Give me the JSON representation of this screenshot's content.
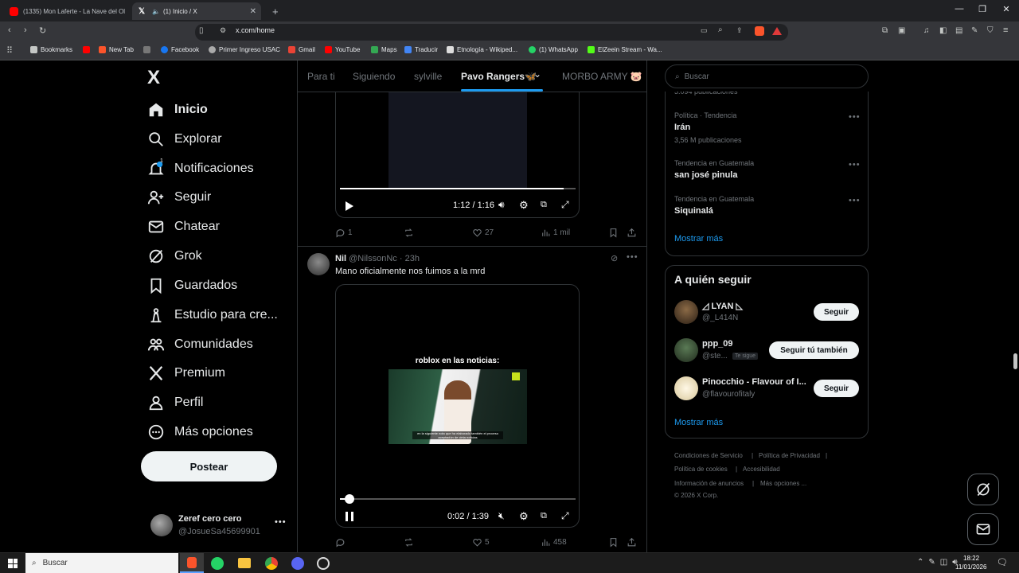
{
  "browser": {
    "tabs": [
      {
        "title": "(1335) Mon Laferte - La Nave del Ol",
        "active": false
      },
      {
        "title": "(1) Inicio / X",
        "active": true
      }
    ],
    "new_tab": "+",
    "url": "x.com/home",
    "bookmarks": [
      "Bookmarks",
      "New Tab",
      "Gmail",
      "Facebook",
      "Primer Ingreso USAC",
      "Gmail",
      "YouTube",
      "Maps",
      "Traducir",
      "Etnología - Wikiped...",
      "(1) WhatsApp",
      "ElZeein Stream - Wa..."
    ]
  },
  "sidebar": {
    "logo": "X",
    "items": [
      {
        "label": "Inicio",
        "icon": "home-icon"
      },
      {
        "label": "Explorar",
        "icon": "search-icon"
      },
      {
        "label": "Notificaciones",
        "icon": "bell-icon",
        "badge": "1"
      },
      {
        "label": "Seguir",
        "icon": "person-add-icon"
      },
      {
        "label": "Chatear",
        "icon": "mail-icon"
      },
      {
        "label": "Grok",
        "icon": "grok-icon"
      },
      {
        "label": "Guardados",
        "icon": "bookmark-icon"
      },
      {
        "label": "Estudio para cre...",
        "icon": "studio-icon"
      },
      {
        "label": "Comunidades",
        "icon": "communities-icon"
      },
      {
        "label": "Premium",
        "icon": "x-icon"
      },
      {
        "label": "Perfil",
        "icon": "person-icon"
      },
      {
        "label": "Más opciones",
        "icon": "more-icon"
      }
    ],
    "post_button": "Postear",
    "account": {
      "name": "Zeref cero cero",
      "handle": "@JosueSa45699901"
    }
  },
  "feed": {
    "tabs": [
      {
        "label": "Para ti"
      },
      {
        "label": "Siguiendo"
      },
      {
        "label": "sylville"
      },
      {
        "label": "Pavo Rangers🦋"
      },
      {
        "label": "MORBO ARMY 🐷"
      }
    ],
    "tweet1": {
      "time": "1:12 / 1:16",
      "progress": 0.95,
      "replies": "1",
      "likes": "27",
      "views": "1 mil"
    },
    "tweet2": {
      "author": "Nil",
      "handle": "@NilssonNc · 23h",
      "text": "Mano oficialmente nos fuimos a la mrd",
      "video_caption": "roblox en las noticias:",
      "news_subtitle": "en la siguiente nota que ha elaborado también el proceso aceptación de cinta noticias",
      "time": "0:02 / 1:39",
      "progress": 0.02,
      "likes": "5",
      "views": "458"
    }
  },
  "right": {
    "search_placeholder": "Buscar",
    "trends_cut": "5.094 publicaciones",
    "trends": [
      {
        "meta": "Política · Tendencia",
        "name": "Irán",
        "count": "3,56 M publicaciones"
      },
      {
        "meta": "Tendencia en Guatemala",
        "name": "san josé pinula",
        "count": ""
      },
      {
        "meta": "Tendencia en Guatemala",
        "name": "Siquinalá",
        "count": ""
      }
    ],
    "show_more": "Mostrar más",
    "who_to_follow_title": "A quién seguir",
    "follow": [
      {
        "name": "◿ LYAN ◺",
        "handle": "@_L414N",
        "button": "Seguir",
        "badge": ""
      },
      {
        "name": "ppp_09",
        "handle": "@ste...",
        "button": "Seguir tú también",
        "badge": "Te sigue"
      },
      {
        "name": "Pinocchio - Flavour of I...",
        "handle": "@flavourofitaly",
        "button": "Seguir",
        "badge": ""
      }
    ],
    "show_more2": "Mostrar más",
    "footer": [
      "Condiciones de Servicio",
      "|",
      "Política de Privacidad",
      "|",
      "Política de cookies",
      "|",
      "Accesibilidad",
      "Información de anuncios",
      "|",
      "Más opciones ...",
      "© 2026 X Corp."
    ]
  },
  "taskbar": {
    "search": "Buscar",
    "time": "18:22",
    "date": "11/01/2026"
  }
}
